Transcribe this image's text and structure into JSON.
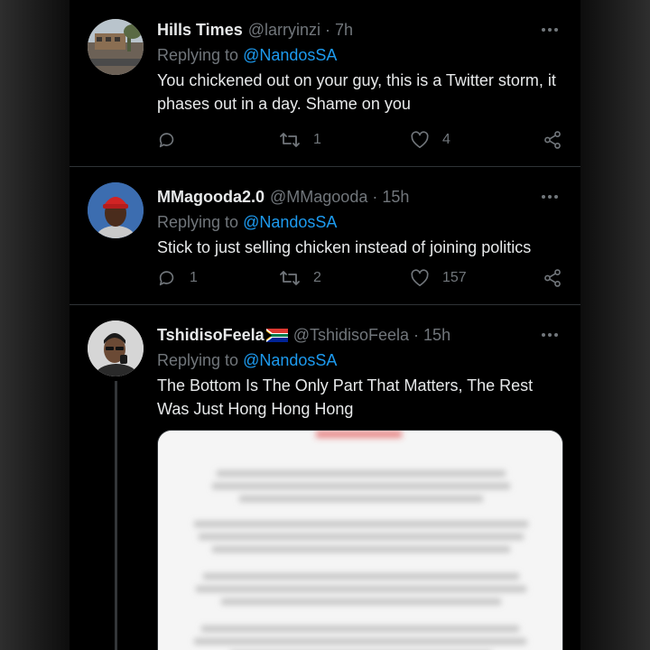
{
  "tweets": [
    {
      "name": "Hills Times",
      "handle": "@larryinzi",
      "separator": "·",
      "time": "7h",
      "replying_prefix": "Replying to",
      "replying_to": "@NandosSA",
      "text": "You chickened out on your guy, this is a Twitter storm, it phases out in a day. Shame on you",
      "replies": "",
      "retweets": "1",
      "likes": "4"
    },
    {
      "name": "MMagooda2.0",
      "handle": "@MMagooda",
      "separator": "·",
      "time": "15h",
      "replying_prefix": "Replying to",
      "replying_to": "@NandosSA",
      "text": "Stick to just selling chicken instead of joining politics",
      "replies": "1",
      "retweets": "2",
      "likes": "157"
    },
    {
      "name": "TshidisoFeela",
      "handle": "@TshidisoFeela",
      "separator": "·",
      "time": "15h",
      "replying_prefix": "Replying to",
      "replying_to": "@NandosSA",
      "text": "The Bottom Is The Only Part That Matters, The Rest Was Just Hong Hong Hong",
      "flag_icon": "south-africa-flag-icon"
    }
  ],
  "colors": {
    "background": "#000000",
    "text": "#e7e9ea",
    "muted": "#71767b",
    "link": "#1d9bf0",
    "divider": "#2f3336"
  },
  "icons": [
    "more-icon",
    "reply-icon",
    "retweet-icon",
    "like-icon",
    "share-icon"
  ]
}
